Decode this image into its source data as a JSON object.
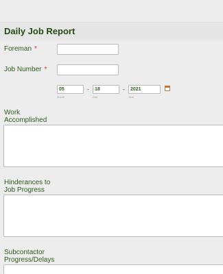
{
  "form": {
    "title": "Daily Job Report",
    "foreman_label": "Foreman",
    "job_number_label": "Job Number",
    "required_mark": "*",
    "date": {
      "month_value": "05",
      "day_value": "18",
      "year_value": "2021",
      "month_sub": "Month",
      "day_sub": "Day",
      "year_sub": "Year",
      "separator": "-"
    },
    "work_label": "Work\nAccomplished",
    "hinderances_label": "Hinderances to\nJob Progress",
    "subcontractor_label": "Subcontactor\nProgress/Delays"
  }
}
